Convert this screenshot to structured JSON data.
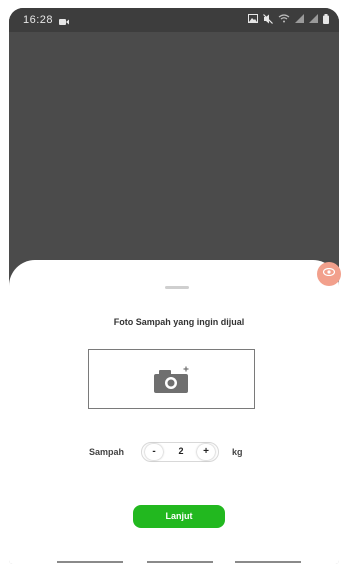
{
  "status_bar": {
    "time": "16:28",
    "video_icon": "video-recording-icon",
    "right_icons": [
      "gallery-icon",
      "mute-icon",
      "wifi-icon",
      "signal-icon",
      "signal-icon",
      "battery-icon"
    ]
  },
  "sheet": {
    "title": "Foto Sampah yang ingin dijual",
    "photo_icon": "camera-icon",
    "quantity": {
      "label": "Sampah",
      "minus": "-",
      "value": "2",
      "plus": "+",
      "unit": "kg"
    },
    "next_button": "Lanjut"
  },
  "floating_badge_icon": "eye-icon",
  "colors": {
    "accent": "#22b81f",
    "overlay": "#4b4b4b",
    "badge": "#f2a08c"
  }
}
